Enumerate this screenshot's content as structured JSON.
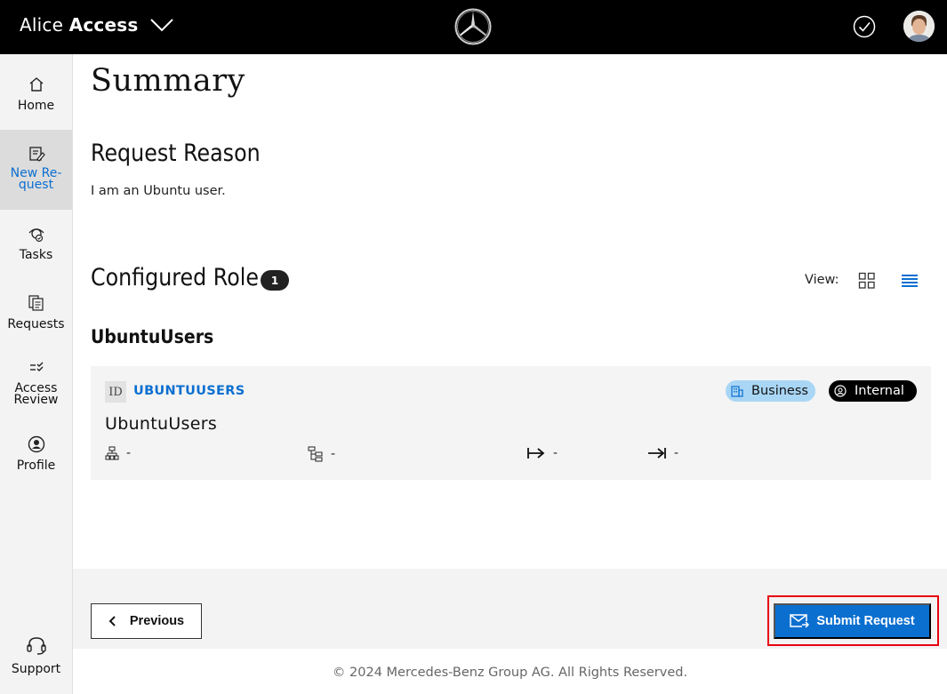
{
  "header": {
    "app_name_light": "Alice",
    "app_name_bold": "Access"
  },
  "sidebar": {
    "items": [
      {
        "label": "Home",
        "icon": "home-icon"
      },
      {
        "label": "New Re-\nquest",
        "icon": "new-request-icon",
        "active": true
      },
      {
        "label": "Tasks",
        "icon": "tasks-icon"
      },
      {
        "label": "Requests",
        "icon": "requests-icon"
      },
      {
        "label": "Access\nReview",
        "icon": "access-review-icon"
      },
      {
        "label": "Profile",
        "icon": "profile-icon"
      },
      {
        "label": "Support",
        "icon": "support-icon"
      }
    ]
  },
  "main": {
    "title": "Summary",
    "reason": {
      "heading": "Request Reason",
      "text": "I am an Ubuntu user."
    },
    "roles": {
      "heading": "Configured Role",
      "count": "1",
      "view_label": "View:",
      "active_view": "list",
      "group_name": "UbuntuUsers",
      "card": {
        "id_label": "ID",
        "id": "UBUNTUUSERS",
        "name": "UbuntuUsers",
        "tag_business": "Business",
        "tag_internal": "Internal",
        "meta": [
          "-",
          "-",
          "-",
          "-"
        ]
      }
    }
  },
  "footer": {
    "previous_label": "Previous",
    "submit_label": "Submit Request",
    "copyright": "© 2024 Mercedes-Benz Group AG. All Rights Reserved."
  },
  "colors": {
    "accent": "#0b6fd0",
    "topbar": "#000000",
    "highlight": "#e8000f",
    "business_tag": "#a9d6f5"
  }
}
